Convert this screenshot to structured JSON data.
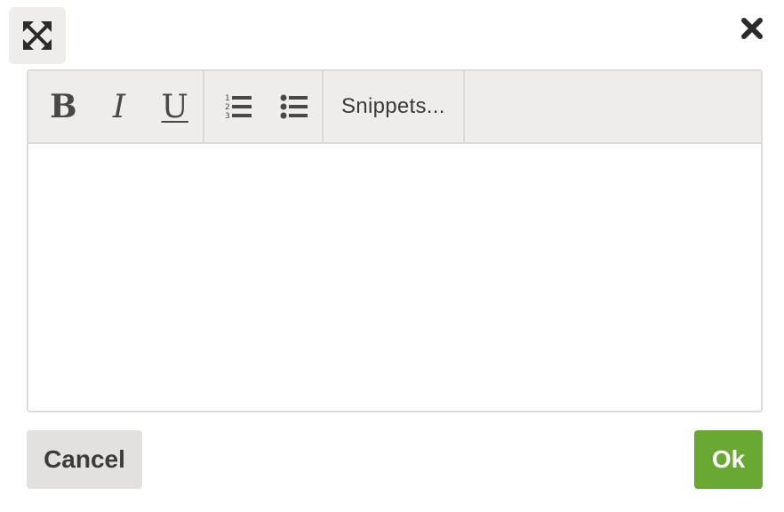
{
  "dialog": {
    "expand_icon": "expand-arrows-icon",
    "close_icon": "close-x-icon"
  },
  "toolbar": {
    "bold_label": "B",
    "italic_label": "I",
    "underline_label": "U",
    "ordered_list_icon": "ordered-list-icon",
    "unordered_list_icon": "unordered-list-icon",
    "snippets_label": "Snippets..."
  },
  "editor": {
    "value": ""
  },
  "actions": {
    "cancel_label": "Cancel",
    "ok_label": "Ok"
  },
  "colors": {
    "accent_ok": "#6aa834",
    "toolbar_bg": "#eeedeb",
    "cancel_bg": "#e3e1df",
    "border": "#dcdbd9"
  }
}
